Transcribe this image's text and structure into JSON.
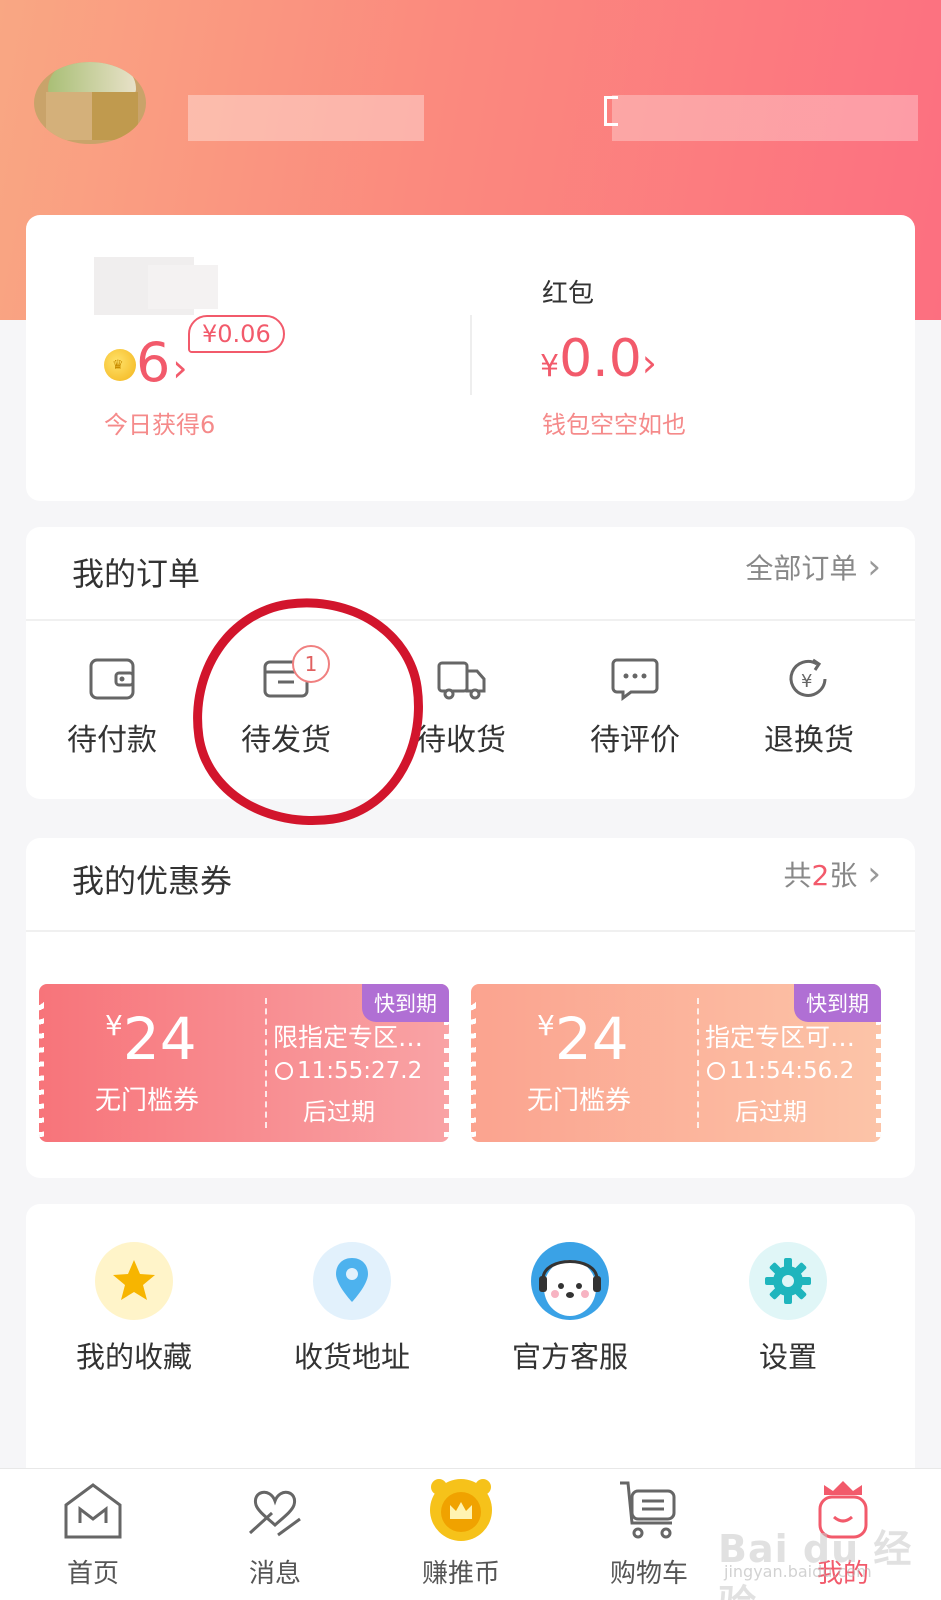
{
  "wallet": {
    "coin_value": "6",
    "coin_badge": "¥0.06",
    "coin_today": "今日获得6",
    "hongbao_label": "红包",
    "hongbao_yen": "¥",
    "hongbao_value": "0.0",
    "hongbao_empty": "钱包空空如也",
    "chevron": "›"
  },
  "orders": {
    "title": "我的订单",
    "all_link": "全部订单",
    "items": [
      {
        "label": "待付款",
        "icon": "wallet-icon"
      },
      {
        "label": "待发货",
        "icon": "card-box-icon",
        "badge": "1"
      },
      {
        "label": "待收货",
        "icon": "truck-icon"
      },
      {
        "label": "待评价",
        "icon": "chat-bubble-icon"
      },
      {
        "label": "退换货",
        "icon": "yen-return-icon"
      }
    ]
  },
  "coupons": {
    "title": "我的优惠券",
    "count_prefix": "共",
    "count": "2",
    "count_suffix": "张",
    "items": [
      {
        "yen": "¥",
        "amount": "24",
        "type": "无门槛券",
        "desc": "限指定专区…",
        "time": "11:55:27.2",
        "after": "后过期",
        "tag": "快到期"
      },
      {
        "yen": "¥",
        "amount": "24",
        "type": "无门槛券",
        "desc": "指定专区可…",
        "time": "11:54:56.2",
        "after": "后过期",
        "tag": "快到期"
      }
    ]
  },
  "tools": [
    {
      "label": "我的收藏",
      "icon": "star-icon"
    },
    {
      "label": "收货地址",
      "icon": "location-pin-icon"
    },
    {
      "label": "官方客服",
      "icon": "customer-service-bear-icon"
    },
    {
      "label": "设置",
      "icon": "gear-icon"
    }
  ],
  "tabbar": [
    {
      "label": "首页",
      "icon": "home-icon"
    },
    {
      "label": "消息",
      "icon": "message-heart-icon"
    },
    {
      "label": "赚推币",
      "icon": "crown-coin-icon"
    },
    {
      "label": "购物车",
      "icon": "cart-icon"
    },
    {
      "label": "我的",
      "icon": "profile-crown-icon",
      "active": true
    }
  ],
  "watermark": {
    "main": "Bai du 经验",
    "sub": "jingyan.baidu.com"
  },
  "colors": {
    "accent": "#f25a6b",
    "annotation": "#d2152c",
    "header_start": "#f9a783",
    "header_end": "#fc6f80"
  }
}
